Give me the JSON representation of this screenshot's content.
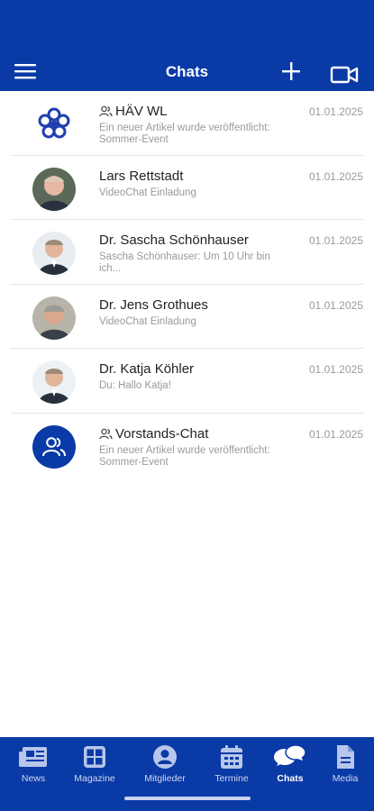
{
  "header": {
    "title": "Chats"
  },
  "chats": [
    {
      "name": "HÄV WL",
      "group": true,
      "preview": "Ein neuer Artikel wurde veröffentlicht: Sommer-Event",
      "date": "01.01.2025",
      "avatar": "logo"
    },
    {
      "name": "Lars Rettstadt",
      "group": false,
      "preview": "VideoChat Einladung",
      "date": "01.01.2025",
      "avatar": "photo"
    },
    {
      "name": "Dr. Sascha Schönhauser",
      "group": false,
      "preview": "Sascha Schönhauser: Um 10 Uhr bin ich...",
      "date": "01.01.2025",
      "avatar": "photo"
    },
    {
      "name": "Dr. Jens Grothues",
      "group": false,
      "preview": "VideoChat Einladung",
      "date": "01.01.2025",
      "avatar": "photo"
    },
    {
      "name": "Dr. Katja Köhler",
      "group": false,
      "preview": "Du: Hallo Katja!",
      "date": "01.01.2025",
      "avatar": "photo"
    },
    {
      "name": "Vorstands-Chat",
      "group": true,
      "preview": "Ein neuer Artikel wurde veröffentlicht: Sommer-Event",
      "date": "01.01.2025",
      "avatar": "group"
    }
  ],
  "nav": [
    {
      "label": "News",
      "icon": "newspaper-icon"
    },
    {
      "label": "Magazine",
      "icon": "grid-icon"
    },
    {
      "label": "Mitglieder",
      "icon": "person-circle-icon"
    },
    {
      "label": "Termine",
      "icon": "calendar-icon"
    },
    {
      "label": "Chats",
      "icon": "chat-bubbles-icon",
      "active": true
    },
    {
      "label": "Media",
      "icon": "document-icon"
    }
  ],
  "colors": {
    "primary": "#0a3aa6",
    "preview_text": "#9a9a9a"
  }
}
